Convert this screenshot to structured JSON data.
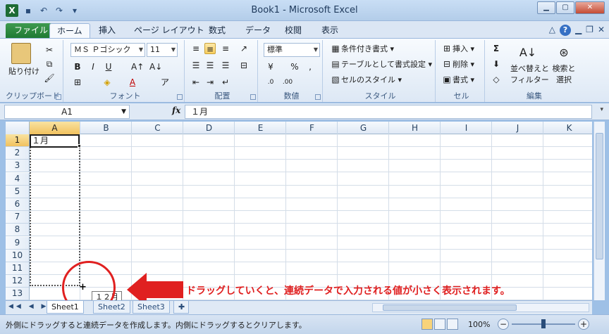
{
  "window": {
    "title": "Book1 - Microsoft Excel"
  },
  "ribbon_tabs": [
    "ファイル",
    "ホーム",
    "挿入",
    "ページ レイアウト",
    "数式",
    "データ",
    "校閲",
    "表示"
  ],
  "clipboard": {
    "paste": "貼り付け",
    "label": "クリップボード"
  },
  "font": {
    "name": "ＭＳ Ｐゴシック",
    "size": "11",
    "label": "フォント"
  },
  "alignment": {
    "label": "配置"
  },
  "number": {
    "format": "標準",
    "label": "数値"
  },
  "styles": {
    "conditional": "条件付き書式",
    "table": "テーブルとして書式設定",
    "cell_styles": "セルのスタイル",
    "label": "スタイル"
  },
  "cells_group": {
    "insert": "挿入",
    "delete": "削除",
    "format": "書式",
    "label": "セル"
  },
  "editing": {
    "sort": "並べ替えと",
    "filter": "フィルター",
    "find": "検索と",
    "select": "選択",
    "label": "編集"
  },
  "formula_bar": {
    "name_box": "A1",
    "fx": "fx",
    "value": "１月"
  },
  "grid": {
    "columns": [
      "A",
      "B",
      "C",
      "D",
      "E",
      "F",
      "G",
      "H",
      "I",
      "J",
      "K"
    ],
    "rows": [
      "1",
      "2",
      "3",
      "4",
      "5",
      "6",
      "7",
      "8",
      "9",
      "10",
      "11",
      "12",
      "13"
    ],
    "a1_value": "１月",
    "drag_tooltip": "１２月"
  },
  "annotation": "ドラッグしていくと、連続データで入力される値が小さく表示されます。",
  "sheets": [
    "Sheet1",
    "Sheet2",
    "Sheet3"
  ],
  "status": {
    "text": "外側にドラッグすると連続データを作成します。内側にドラッグするとクリアします。",
    "zoom": "100%"
  },
  "colors": {
    "annotation_red": "#e02020",
    "file_tab_green": "#1f7a33"
  }
}
